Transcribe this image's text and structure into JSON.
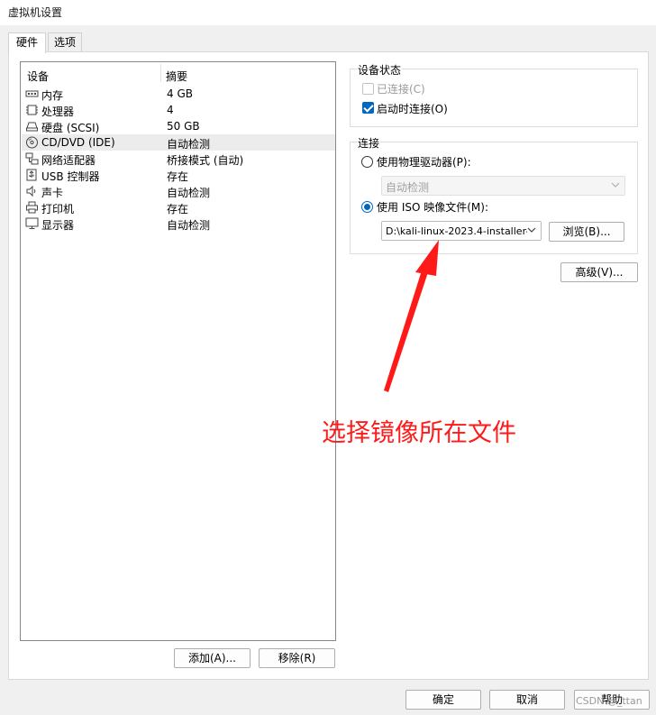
{
  "window": {
    "title": "虚拟机设置"
  },
  "tabs": [
    {
      "label": "硬件",
      "active": true
    },
    {
      "label": "选项",
      "active": false
    }
  ],
  "device_list": {
    "headers": {
      "device": "设备",
      "summary": "摘要"
    },
    "rows": [
      {
        "name": "内存",
        "summary": "4 GB",
        "icon": "memory-icon",
        "selected": false
      },
      {
        "name": "处理器",
        "summary": "4",
        "icon": "processor-icon",
        "selected": false
      },
      {
        "name": "硬盘 (SCSI)",
        "summary": "50 GB",
        "icon": "hard-disk-icon",
        "selected": false
      },
      {
        "name": "CD/DVD (IDE)",
        "summary": "自动检测",
        "icon": "cd-dvd-icon",
        "selected": true
      },
      {
        "name": "网络适配器",
        "summary": "桥接模式 (自动)",
        "icon": "network-adapter-icon",
        "selected": false
      },
      {
        "name": "USB 控制器",
        "summary": "存在",
        "icon": "usb-icon",
        "selected": false
      },
      {
        "name": "声卡",
        "summary": "自动检测",
        "icon": "speaker-icon",
        "selected": false
      },
      {
        "name": "打印机",
        "summary": "存在",
        "icon": "printer-icon",
        "selected": false
      },
      {
        "name": "显示器",
        "summary": "自动检测",
        "icon": "monitor-icon",
        "selected": false
      }
    ],
    "add_button": "添加(A)...",
    "remove_button": "移除(R)"
  },
  "device_status": {
    "title": "设备状态",
    "connected": {
      "label": "已连接(C)",
      "checked": false,
      "disabled": true
    },
    "connect_at_power_on": {
      "label": "启动时连接(O)",
      "checked": true
    }
  },
  "connection": {
    "title": "连接",
    "physical_drive": {
      "label": "使用物理驱动器(P):",
      "selected": false
    },
    "physical_drive_combo": "自动检测",
    "iso_image": {
      "label": "使用 ISO 映像文件(M):",
      "selected": true
    },
    "iso_path": "D:\\kali-linux-2023.4-installer-",
    "browse_button": "浏览(B)..."
  },
  "advanced_button": "高级(V)...",
  "annotation": "选择镜像所在文件",
  "footer": {
    "ok": "确定",
    "cancel": "取消",
    "help": "帮助"
  },
  "watermark": "CSDN @_ttan",
  "colors": {
    "accent": "#0067c0",
    "annotation": "#ff1a1a"
  }
}
